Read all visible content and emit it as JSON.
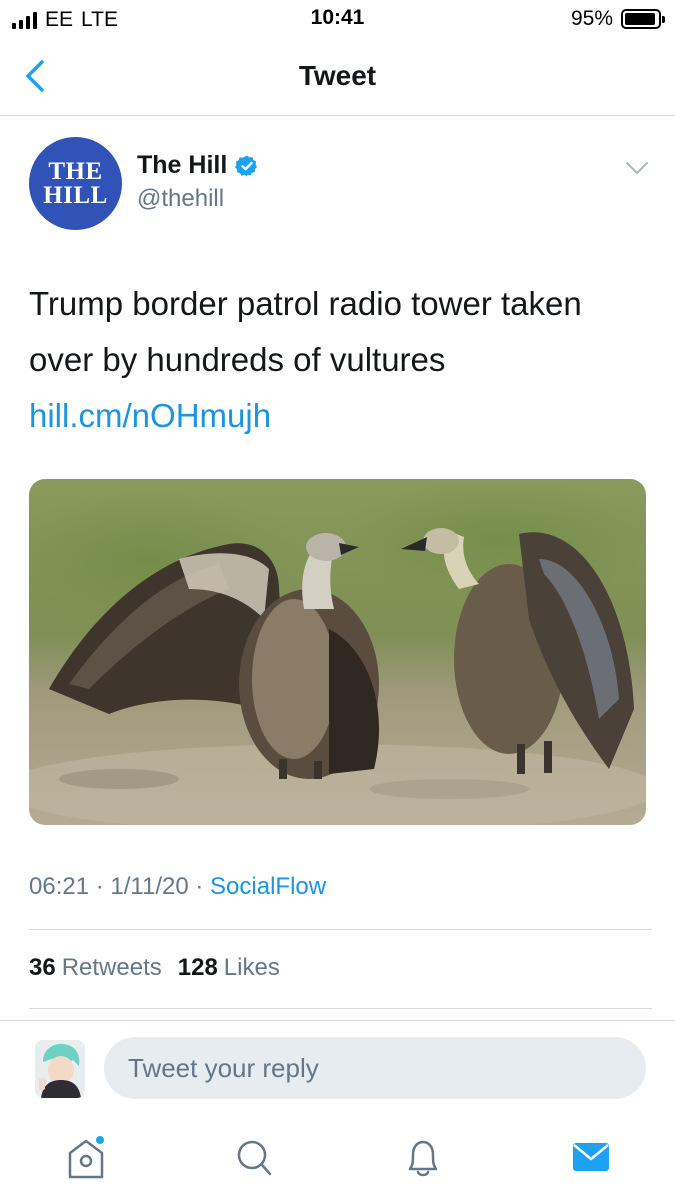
{
  "status_bar": {
    "carrier": "EE",
    "network": "LTE",
    "time": "10:41",
    "battery": "95%",
    "battery_level": 0.95
  },
  "nav": {
    "title": "Tweet",
    "back_icon": "chevron-left-icon"
  },
  "tweet": {
    "author": {
      "name": "The Hill",
      "handle": "@thehill",
      "verified": true,
      "avatar_line1": "THE",
      "avatar_line2": "HILL"
    },
    "text": "Trump border patrol radio tower taken over by hundreds of vultures",
    "link": "hill.cm/nOHmujh",
    "media_icon": "vultures-photo",
    "time": "06:21",
    "date": "1/11/20",
    "separator": "·",
    "source": "SocialFlow",
    "retweets_count": "36",
    "retweets_label": "Retweets",
    "likes_count": "128",
    "likes_label": "Likes"
  },
  "reply": {
    "placeholder": "Tweet your reply"
  },
  "tabs": [
    {
      "icon": "home-icon",
      "has_notification_dot": true
    },
    {
      "icon": "search-icon"
    },
    {
      "icon": "bell-icon"
    },
    {
      "icon": "mail-icon",
      "active": true
    }
  ],
  "colors": {
    "accent": "#1da1f2",
    "link": "#1b95e0",
    "secondary_text": "#657786",
    "hill_blue": "#3152b7"
  }
}
